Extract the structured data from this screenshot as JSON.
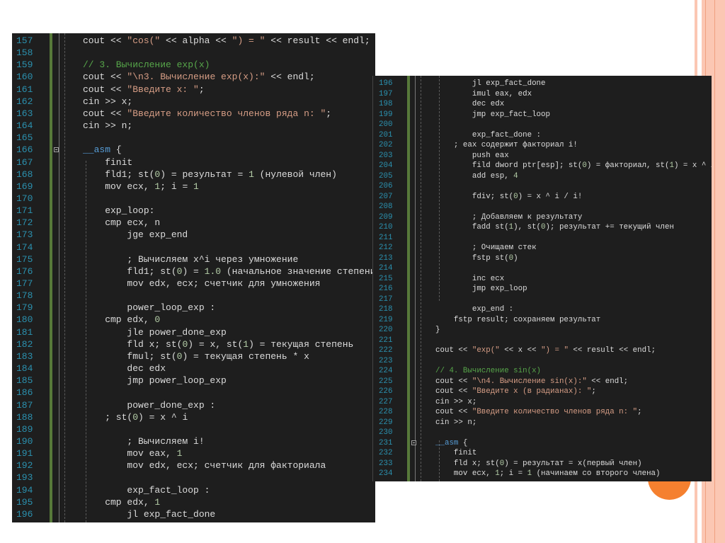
{
  "colors": {
    "accent_orange": "#f5802f",
    "stripe": "#fbc7b3",
    "editor_bg": "#1e1e1e",
    "line_number": "#2b91af",
    "string": "#d69d85",
    "comment": "#57a64a",
    "keyword": "#569cd6",
    "number": "#b5cea8",
    "change_bar": "#57793a"
  },
  "left_editor": {
    "fold_lines": [
      166
    ],
    "lines": [
      {
        "n": "157",
        "t": [
          [
            "cout << ",
            "p"
          ],
          [
            "\"cos(\"",
            "s"
          ],
          [
            " << alpha << ",
            "p"
          ],
          [
            "\") = \"",
            "s"
          ],
          [
            " << result << endl;",
            "p"
          ]
        ]
      },
      {
        "n": "158",
        "t": []
      },
      {
        "n": "159",
        "t": [
          [
            "// 3. Вычисление exp(x)",
            "c"
          ]
        ]
      },
      {
        "n": "160",
        "t": [
          [
            "cout << ",
            "p"
          ],
          [
            "\"\\n3. Вычисление exp(x):\"",
            "s"
          ],
          [
            " << endl;",
            "p"
          ]
        ]
      },
      {
        "n": "161",
        "t": [
          [
            "cout << ",
            "p"
          ],
          [
            "\"Введите x: \"",
            "s"
          ],
          [
            ";",
            "p"
          ]
        ]
      },
      {
        "n": "162",
        "t": [
          [
            "cin >> x;",
            "p"
          ]
        ]
      },
      {
        "n": "163",
        "t": [
          [
            "cout << ",
            "p"
          ],
          [
            "\"Введите количество членов ряда n: \"",
            "s"
          ],
          [
            ";",
            "p"
          ]
        ]
      },
      {
        "n": "164",
        "t": [
          [
            "cin >> n;",
            "p"
          ]
        ]
      },
      {
        "n": "165",
        "t": []
      },
      {
        "n": "166",
        "t": [
          [
            "__asm",
            "k"
          ],
          [
            " {",
            "p"
          ]
        ]
      },
      {
        "n": "167",
        "t": [
          [
            "    finit",
            "p"
          ]
        ]
      },
      {
        "n": "168",
        "t": [
          [
            "    fld1; st(",
            "p"
          ],
          [
            "0",
            "n"
          ],
          [
            ") = результат = ",
            "p"
          ],
          [
            "1",
            "n"
          ],
          [
            " (нулевой член)",
            "p"
          ]
        ]
      },
      {
        "n": "169",
        "t": [
          [
            "    mov ecx, ",
            "p"
          ],
          [
            "1",
            "n"
          ],
          [
            "; i = ",
            "p"
          ],
          [
            "1",
            "n"
          ]
        ]
      },
      {
        "n": "170",
        "t": []
      },
      {
        "n": "171",
        "t": [
          [
            "    exp_loop:",
            "p"
          ]
        ]
      },
      {
        "n": "172",
        "t": [
          [
            "    cmp ecx, n",
            "p"
          ]
        ]
      },
      {
        "n": "173",
        "t": [
          [
            "        jge exp_end",
            "p"
          ]
        ]
      },
      {
        "n": "174",
        "t": []
      },
      {
        "n": "175",
        "t": [
          [
            "        ; Вычисляем x^i через умножение",
            "p"
          ]
        ]
      },
      {
        "n": "176",
        "t": [
          [
            "        fld1; st(",
            "p"
          ],
          [
            "0",
            "n"
          ],
          [
            ") = ",
            "p"
          ],
          [
            "1.0",
            "n"
          ],
          [
            " (начальное значение степени)",
            "p"
          ]
        ]
      },
      {
        "n": "177",
        "t": [
          [
            "        mov edx, ecx; счетчик для умножения",
            "p"
          ]
        ]
      },
      {
        "n": "178",
        "t": []
      },
      {
        "n": "179",
        "t": [
          [
            "        power_loop_exp :",
            "p"
          ]
        ]
      },
      {
        "n": "180",
        "t": [
          [
            "    cmp edx, ",
            "p"
          ],
          [
            "0",
            "n"
          ]
        ]
      },
      {
        "n": "181",
        "t": [
          [
            "        jle power_done_exp",
            "p"
          ]
        ]
      },
      {
        "n": "182",
        "t": [
          [
            "        fld x; st(",
            "p"
          ],
          [
            "0",
            "n"
          ],
          [
            ") = x, st(",
            "p"
          ],
          [
            "1",
            "n"
          ],
          [
            ") = текущая степень",
            "p"
          ]
        ]
      },
      {
        "n": "183",
        "t": [
          [
            "        fmul; st(",
            "p"
          ],
          [
            "0",
            "n"
          ],
          [
            ") = текущая степень * x",
            "p"
          ]
        ]
      },
      {
        "n": "184",
        "t": [
          [
            "        dec edx",
            "p"
          ]
        ]
      },
      {
        "n": "185",
        "t": [
          [
            "        jmp power_loop_exp",
            "p"
          ]
        ]
      },
      {
        "n": "186",
        "t": []
      },
      {
        "n": "187",
        "t": [
          [
            "        power_done_exp :",
            "p"
          ]
        ]
      },
      {
        "n": "188",
        "t": [
          [
            "    ; st(",
            "p"
          ],
          [
            "0",
            "n"
          ],
          [
            ") = x ^ i",
            "p"
          ]
        ]
      },
      {
        "n": "189",
        "t": []
      },
      {
        "n": "190",
        "t": [
          [
            "        ; Вычисляем i!",
            "p"
          ]
        ]
      },
      {
        "n": "191",
        "t": [
          [
            "        mov eax, ",
            "p"
          ],
          [
            "1",
            "n"
          ]
        ]
      },
      {
        "n": "192",
        "t": [
          [
            "        mov edx, ecx; счетчик для факториала",
            "p"
          ]
        ]
      },
      {
        "n": "193",
        "t": []
      },
      {
        "n": "194",
        "t": [
          [
            "        exp_fact_loop :",
            "p"
          ]
        ]
      },
      {
        "n": "195",
        "t": [
          [
            "    cmp edx, ",
            "p"
          ],
          [
            "1",
            "n"
          ]
        ]
      },
      {
        "n": "196",
        "t": [
          [
            "        jl exp_fact_done",
            "p"
          ]
        ]
      }
    ]
  },
  "right_editor": {
    "fold_lines": [
      231
    ],
    "lines": [
      {
        "n": "196",
        "t": [
          [
            "        jl exp_fact_done",
            "p"
          ]
        ]
      },
      {
        "n": "197",
        "t": [
          [
            "        imul eax, edx",
            "p"
          ]
        ]
      },
      {
        "n": "198",
        "t": [
          [
            "        dec edx",
            "p"
          ]
        ]
      },
      {
        "n": "199",
        "t": [
          [
            "        jmp exp_fact_loop",
            "p"
          ]
        ]
      },
      {
        "n": "200",
        "t": []
      },
      {
        "n": "201",
        "t": [
          [
            "        exp_fact_done :",
            "p"
          ]
        ]
      },
      {
        "n": "202",
        "t": [
          [
            "    ; eax содержит факториал i!",
            "p"
          ]
        ]
      },
      {
        "n": "203",
        "t": [
          [
            "        push eax",
            "p"
          ]
        ]
      },
      {
        "n": "204",
        "t": [
          [
            "        fild dword ptr[esp]; st(",
            "p"
          ],
          [
            "0",
            "n"
          ],
          [
            ") = факториал, st(",
            "p"
          ],
          [
            "1",
            "n"
          ],
          [
            ") = x ^ i",
            "p"
          ]
        ]
      },
      {
        "n": "205",
        "t": [
          [
            "        add esp, ",
            "p"
          ],
          [
            "4",
            "n"
          ]
        ]
      },
      {
        "n": "206",
        "t": []
      },
      {
        "n": "207",
        "t": [
          [
            "        fdiv; st(",
            "p"
          ],
          [
            "0",
            "n"
          ],
          [
            ") = x ^ i / i!",
            "p"
          ]
        ]
      },
      {
        "n": "208",
        "t": []
      },
      {
        "n": "209",
        "t": [
          [
            "        ; Добавляем к результату",
            "p"
          ]
        ]
      },
      {
        "n": "210",
        "t": [
          [
            "        fadd st(",
            "p"
          ],
          [
            "1",
            "n"
          ],
          [
            "), st(",
            "p"
          ],
          [
            "0",
            "n"
          ],
          [
            "); результат += текущий член",
            "p"
          ]
        ]
      },
      {
        "n": "211",
        "t": []
      },
      {
        "n": "212",
        "t": [
          [
            "        ; Очищаем стек",
            "p"
          ]
        ]
      },
      {
        "n": "213",
        "t": [
          [
            "        fstp st(",
            "p"
          ],
          [
            "0",
            "n"
          ],
          [
            ")",
            "p"
          ]
        ]
      },
      {
        "n": "214",
        "t": []
      },
      {
        "n": "215",
        "t": [
          [
            "        inc ecx",
            "p"
          ]
        ]
      },
      {
        "n": "216",
        "t": [
          [
            "        jmp exp_loop",
            "p"
          ]
        ]
      },
      {
        "n": "217",
        "t": []
      },
      {
        "n": "218",
        "t": [
          [
            "        exp_end :",
            "p"
          ]
        ]
      },
      {
        "n": "219",
        "t": [
          [
            "    fstp result; сохраняем результат",
            "p"
          ]
        ]
      },
      {
        "n": "220",
        "t": [
          [
            "}",
            "p"
          ]
        ]
      },
      {
        "n": "221",
        "t": []
      },
      {
        "n": "222",
        "t": [
          [
            "cout << ",
            "p"
          ],
          [
            "\"exp(\"",
            "s"
          ],
          [
            " << x << ",
            "p"
          ],
          [
            "\") = \"",
            "s"
          ],
          [
            " << result << endl;",
            "p"
          ]
        ]
      },
      {
        "n": "223",
        "t": []
      },
      {
        "n": "224",
        "t": [
          [
            "// 4. Вычисление sin(x)",
            "c"
          ]
        ]
      },
      {
        "n": "225",
        "t": [
          [
            "cout << ",
            "p"
          ],
          [
            "\"\\n4. Вычисление sin(x):\"",
            "s"
          ],
          [
            " << endl;",
            "p"
          ]
        ]
      },
      {
        "n": "226",
        "t": [
          [
            "cout << ",
            "p"
          ],
          [
            "\"Введите x (в радианах): \"",
            "s"
          ],
          [
            ";",
            "p"
          ]
        ]
      },
      {
        "n": "227",
        "t": [
          [
            "cin >> x;",
            "p"
          ]
        ]
      },
      {
        "n": "228",
        "t": [
          [
            "cout << ",
            "p"
          ],
          [
            "\"Введите количество членов ряда n: \"",
            "s"
          ],
          [
            ";",
            "p"
          ]
        ]
      },
      {
        "n": "229",
        "t": [
          [
            "cin >> n;",
            "p"
          ]
        ]
      },
      {
        "n": "230",
        "t": []
      },
      {
        "n": "231",
        "t": [
          [
            "__asm",
            "k"
          ],
          [
            " {",
            "p"
          ]
        ]
      },
      {
        "n": "232",
        "t": [
          [
            "    finit",
            "p"
          ]
        ]
      },
      {
        "n": "233",
        "t": [
          [
            "    fld x; st(",
            "p"
          ],
          [
            "0",
            "n"
          ],
          [
            ") = результат = x(первый член)",
            "p"
          ]
        ]
      },
      {
        "n": "234",
        "t": [
          [
            "    mov ecx, ",
            "p"
          ],
          [
            "1",
            "n"
          ],
          [
            "; i = ",
            "p"
          ],
          [
            "1",
            "n"
          ],
          [
            " (начинаем со второго члена)",
            "p"
          ]
        ]
      }
    ]
  }
}
